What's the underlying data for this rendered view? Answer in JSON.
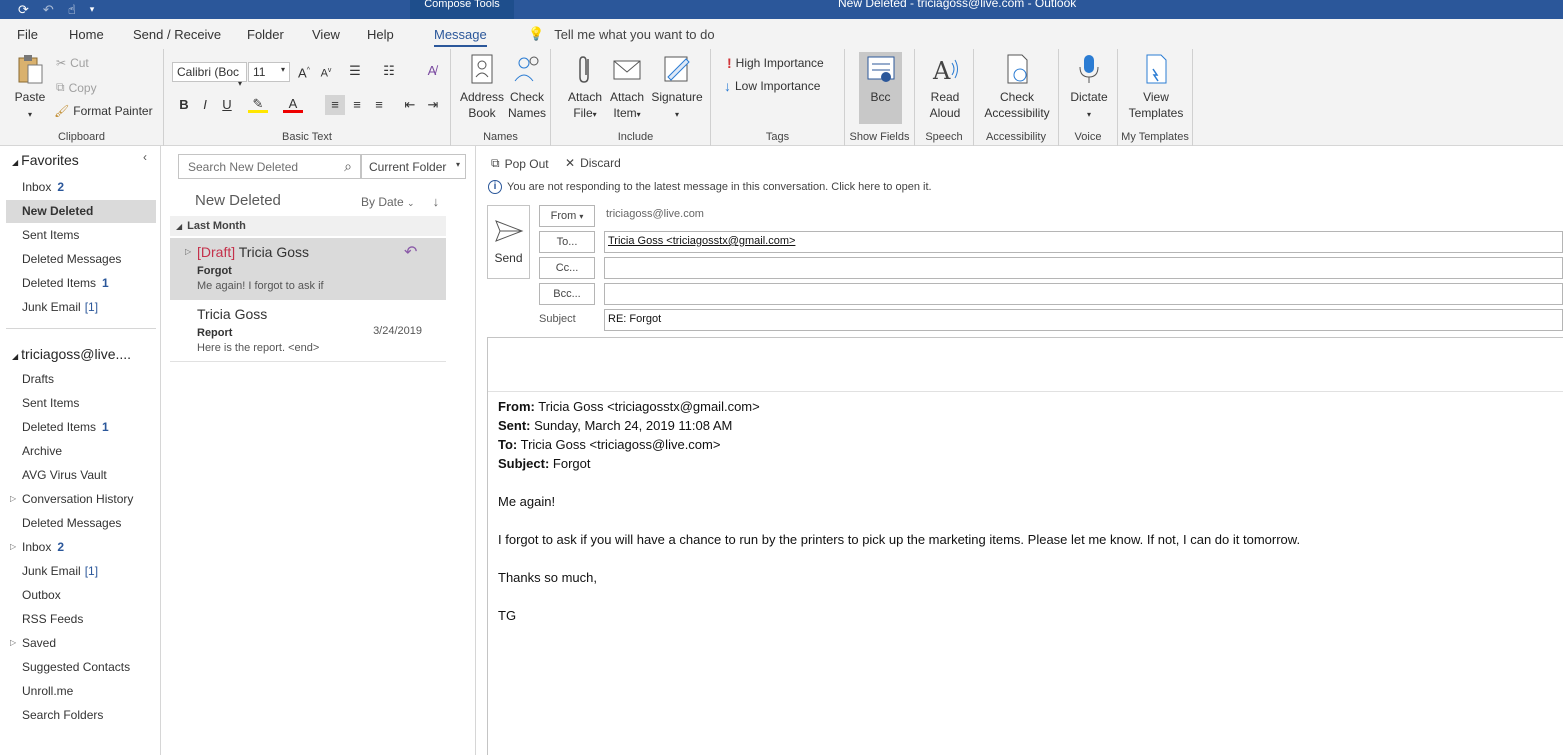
{
  "titlebar": {
    "context_tab": "Compose Tools",
    "window_title": "New Deleted - triciagoss@live.com  -  Outlook"
  },
  "menu": {
    "tabs": [
      "File",
      "Home",
      "Send / Receive",
      "Folder",
      "View",
      "Help",
      "Message"
    ],
    "active_tab": "Message",
    "tell_me": "Tell me what you want to do"
  },
  "ribbon": {
    "clipboard": {
      "paste": "Paste",
      "cut": "Cut",
      "copy": "Copy",
      "format_painter": "Format Painter",
      "label": "Clipboard"
    },
    "basic_text": {
      "font": "Calibri (Boc",
      "size": "11",
      "label": "Basic Text",
      "bold": "B",
      "italic": "I",
      "underline": "U"
    },
    "names": {
      "address_book_1": "Address",
      "address_book_2": "Book",
      "check_names_1": "Check",
      "check_names_2": "Names",
      "label": "Names"
    },
    "include": {
      "attach_file_1": "Attach",
      "attach_file_2": "File",
      "attach_item_1": "Attach",
      "attach_item_2": "Item",
      "signature": "Signature",
      "label": "Include"
    },
    "tags": {
      "high": "High Importance",
      "low": "Low Importance",
      "label": "Tags"
    },
    "show_fields": {
      "bcc": "Bcc",
      "label": "Show Fields"
    },
    "speech": {
      "read_aloud_1": "Read",
      "read_aloud_2": "Aloud",
      "label": "Speech"
    },
    "accessibility": {
      "check_1": "Check",
      "check_2": "Accessibility",
      "label": "Accessibility"
    },
    "voice": {
      "dictate": "Dictate",
      "label": "Voice"
    },
    "templates": {
      "view_1": "View",
      "view_2": "Templates",
      "label": "My Templates"
    }
  },
  "nav": {
    "favorites_header": "Favorites",
    "favorites": [
      {
        "label": "Inbox",
        "count": "2"
      },
      {
        "label": "New Deleted",
        "count": ""
      },
      {
        "label": "Sent Items",
        "count": ""
      },
      {
        "label": "Deleted Messages",
        "count": ""
      },
      {
        "label": "Deleted Items",
        "count": "1"
      },
      {
        "label": "Junk Email",
        "bracket": "[1]"
      }
    ],
    "account_header": "triciagoss@live....",
    "folders": [
      {
        "label": "Drafts"
      },
      {
        "label": "Sent Items"
      },
      {
        "label": "Deleted Items",
        "count": "1"
      },
      {
        "label": "Archive"
      },
      {
        "label": "AVG Virus Vault"
      },
      {
        "label": "Conversation History"
      },
      {
        "label": "Deleted Messages"
      },
      {
        "label": "Inbox",
        "count": "2"
      },
      {
        "label": "Junk Email",
        "bracket": "[1]"
      },
      {
        "label": "Outbox"
      },
      {
        "label": "RSS Feeds"
      },
      {
        "label": "Saved"
      },
      {
        "label": "Suggested Contacts"
      },
      {
        "label": "Unroll.me"
      },
      {
        "label": "Search Folders"
      }
    ]
  },
  "list": {
    "search_placeholder": "Search New Deleted",
    "scope": "Current Folder",
    "folder_title": "New Deleted",
    "sort": "By Date",
    "group_header": "Last Month",
    "items": [
      {
        "draft_tag": "[Draft]",
        "sender": "Tricia Goss",
        "subject": "Forgot",
        "preview": "Me again!  I forgot to ask if",
        "date": ""
      },
      {
        "draft_tag": "",
        "sender": "Tricia Goss",
        "subject": "Report",
        "preview": "Here is the report. <end>",
        "date": "3/24/2019"
      }
    ]
  },
  "compose": {
    "pop_out": "Pop Out",
    "discard": "Discard",
    "info": "You are not responding to the latest message in this conversation. Click here to open it.",
    "send": "Send",
    "from_btn": "From",
    "from_addr": "triciagoss@live.com",
    "to_btn": "To...",
    "to_value": "Tricia Goss <triciagosstx@gmail.com>",
    "cc_btn": "Cc...",
    "bcc_btn": "Bcc...",
    "subject_label": "Subject",
    "subject_value": "RE: Forgot",
    "quoted": {
      "from_label": "From:",
      "from_value": " Tricia Goss <triciagosstx@gmail.com>",
      "sent_label": "Sent:",
      "sent_value": " Sunday, March 24, 2019 11:08 AM",
      "to_label": "To:",
      "to_value": " Tricia Goss <triciagoss@live.com>",
      "subject_label": "Subject:",
      "subject_value": " Forgot"
    },
    "body_lines": [
      "Me again!",
      "I forgot to ask if you will have a chance to run by the printers to pick up the marketing items. Please let me know. If not, I can do it tomorrow.",
      "Thanks so much,",
      "TG"
    ]
  }
}
